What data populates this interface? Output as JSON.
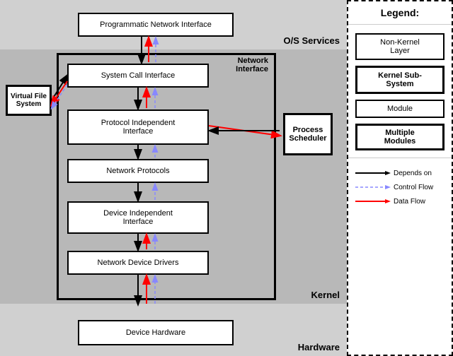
{
  "sections": {
    "os": "O/S Services",
    "kernel": "Kernel",
    "hardware": "Hardware"
  },
  "boxes": {
    "pni": "Programmatic Network Interface",
    "vfs": "Virtual File\nSystem",
    "ps": "Process\nScheduler",
    "network_interface": "Network\nInterface",
    "sci": "System Call Interface",
    "pii": "Protocol Independent\nInterface",
    "np": "Network Protocols",
    "dii": "Device Independent\nInterface",
    "ndd": "Network Device Drivers",
    "dh": "Device Hardware"
  },
  "legend": {
    "title": "Legend:",
    "items": [
      {
        "label": "Non-Kernel\nLayer",
        "type": "thin"
      },
      {
        "label": "Kernel Sub-\nSystem",
        "type": "bold"
      },
      {
        "label": "Module",
        "type": "thin"
      },
      {
        "label": "Multiple\nModules",
        "type": "multi"
      }
    ],
    "arrows": [
      {
        "label": "Depends on",
        "color": "black",
        "style": "solid"
      },
      {
        "label": "Control Flow",
        "color": "#8888ff",
        "style": "dashed"
      },
      {
        "label": "Data Flow",
        "color": "red",
        "style": "solid"
      }
    ]
  }
}
